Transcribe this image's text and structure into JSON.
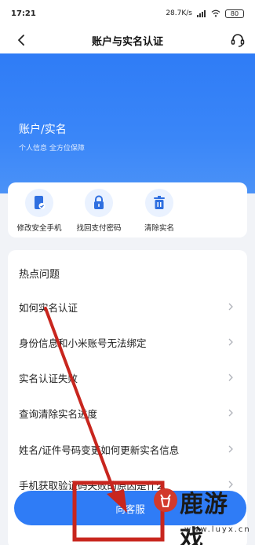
{
  "status_bar": {
    "time": "17:21",
    "network_speed": "28.7K/s",
    "battery": "80"
  },
  "header": {
    "title": "账户与实名认证"
  },
  "hero": {
    "title": "账户/实名",
    "subtitle": "个人信息 全方位保障",
    "color": "#2f7cf6"
  },
  "actions": [
    {
      "label": "修改安全手机",
      "icon": "phone-icon"
    },
    {
      "label": "找回支付密码",
      "icon": "lock-icon"
    },
    {
      "label": "清除实名",
      "icon": "trash-icon"
    }
  ],
  "faq": {
    "header": "热点问题",
    "items": [
      "如何实名认证",
      "身份信息和小米账号无法绑定",
      "实名认证失败",
      "查询清除实名进度",
      "姓名/证件号码变更如何更新实名信息",
      "手机获取验证码失败的原因是什么"
    ]
  },
  "bottom_button": {
    "label": "向客服"
  },
  "watermark": {
    "text": "鹿游戏",
    "url": "www.luyx.cn"
  },
  "colors": {
    "accent": "#2f7cf6",
    "annotation_red": "#c8261e"
  }
}
